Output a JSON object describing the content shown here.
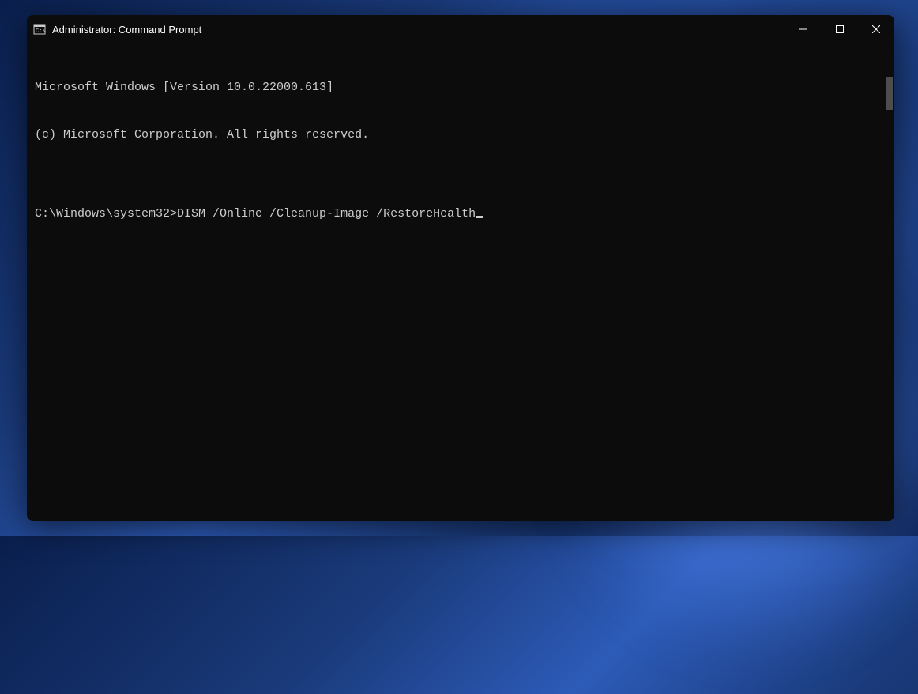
{
  "window": {
    "title": "Administrator: Command Prompt"
  },
  "terminal": {
    "line1": "Microsoft Windows [Version 10.0.22000.613]",
    "line2": "(c) Microsoft Corporation. All rights reserved.",
    "blank": "",
    "prompt": "C:\\Windows\\system32>",
    "command": "DISM /Online /Cleanup-Image /RestoreHealth"
  }
}
